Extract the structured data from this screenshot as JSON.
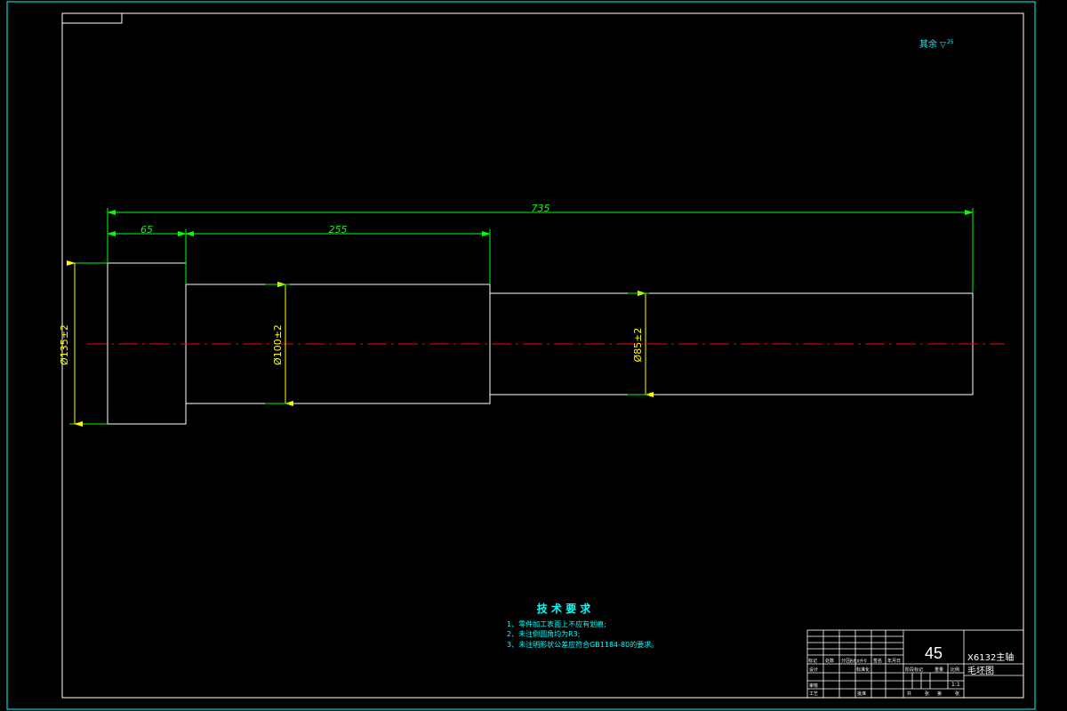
{
  "colors": {
    "background": "#000000",
    "outline": "#ffffff",
    "frame": "#00ffff",
    "dimension": "#00ff00",
    "dim_text": "#ffff00",
    "centerline": "#ff0000",
    "notes": "#00ffff"
  },
  "roughness_note": {
    "label": "其余",
    "symbol": "▽",
    "value": "25"
  },
  "dimensions": {
    "overall_length": "735",
    "head_length": "65",
    "mid_length": "255",
    "dia_head": "Ø135±2",
    "dia_mid": "Ø100±2",
    "dia_tail": "Ø85±2"
  },
  "tech_requirements": {
    "title": "技 术 要 求",
    "items": [
      "1、零件加工表面上不应有划痕;",
      "2、未注倒圆角均为R3;",
      "3、未注明形状公差应符合GB1184-80的要求。"
    ]
  },
  "title_block": {
    "material": "45",
    "name_line1": "X6132主轴",
    "name_line2": "毛坯图",
    "revision_labels": [
      "标记",
      "处数",
      "分区",
      "更改文件号",
      "签名",
      "年月日"
    ],
    "role_labels": [
      "设计",
      "标准化",
      "审核",
      "工艺",
      "批准"
    ],
    "stage_labels": [
      "阶段标记",
      "重量",
      "比例"
    ],
    "scale": "1:1",
    "sheet_labels": [
      "共",
      "张",
      "第",
      "张"
    ]
  }
}
